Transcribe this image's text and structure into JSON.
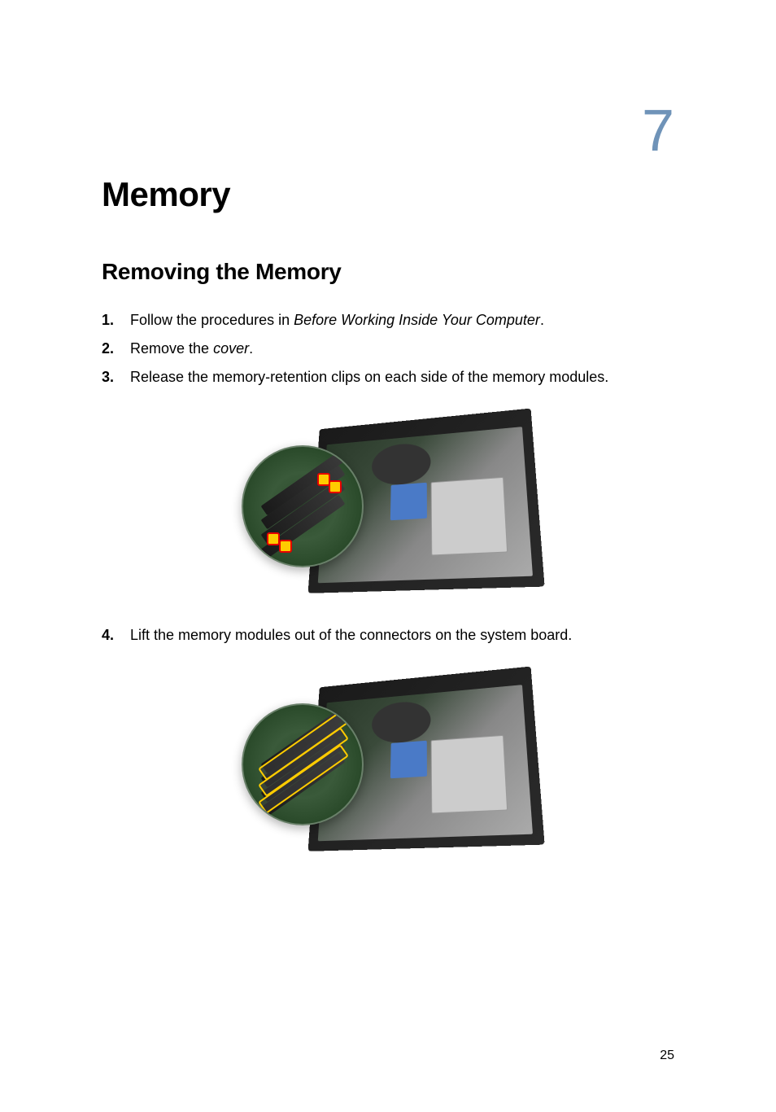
{
  "chapter": {
    "number": "7",
    "title": "Memory"
  },
  "section": {
    "title": "Removing the Memory"
  },
  "steps": [
    {
      "number": "1.",
      "text_before": "Follow the procedures in ",
      "text_italic": "Before Working Inside Your Computer",
      "text_after": "."
    },
    {
      "number": "2.",
      "text_before": "Remove the ",
      "text_italic": "cover",
      "text_after": "."
    },
    {
      "number": "3.",
      "text_before": "Release the memory-retention clips on each side of the memory modules.",
      "text_italic": "",
      "text_after": ""
    },
    {
      "number": "4.",
      "text_before": "Lift the memory modules out of the connectors on the system board.",
      "text_italic": "",
      "text_after": ""
    }
  ],
  "page_number": "25"
}
